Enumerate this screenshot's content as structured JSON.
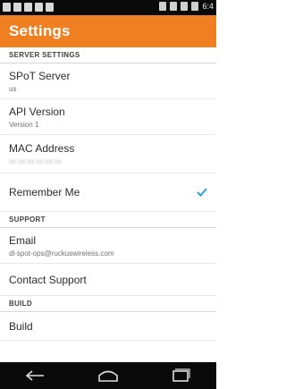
{
  "status_bar": {
    "time": "6:4",
    "left_icons": [
      "image-icon",
      "notification-icon",
      "email-icon",
      "app-icon",
      "app-icon-2"
    ],
    "right_icons": [
      "vibrate-icon",
      "signal-icon",
      "wifi-icon",
      "battery-icon"
    ]
  },
  "app_bar": {
    "title": "Settings",
    "color": "#f07f22"
  },
  "sections": [
    {
      "header": "SERVER SETTINGS",
      "items": [
        {
          "title": "SPoT Server",
          "subtitle": "us"
        },
        {
          "title": "API Version",
          "subtitle": "Version 1"
        },
        {
          "title": "MAC Address",
          "subtitle": "xx:xx:xx:xx:xx:xx"
        },
        {
          "title": "Remember Me",
          "checked": true
        }
      ]
    },
    {
      "header": "SUPPORT",
      "items": [
        {
          "title": "Email",
          "subtitle": "dl-spot-ops@ruckuswireless.com"
        },
        {
          "title": "Contact Support"
        }
      ]
    },
    {
      "header": "BUILD",
      "items": [
        {
          "title": "Build"
        }
      ]
    }
  ],
  "nav_bar": {
    "buttons": [
      "back-icon",
      "home-icon",
      "recent-apps-icon"
    ]
  }
}
